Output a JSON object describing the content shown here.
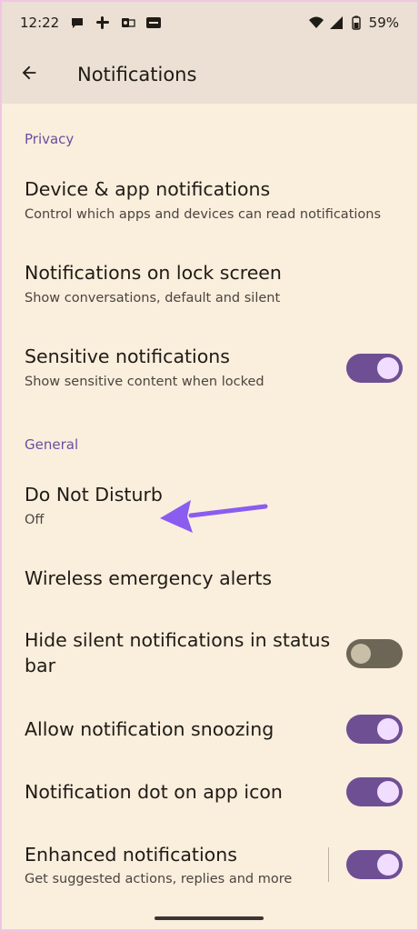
{
  "status_bar": {
    "time": "12:22",
    "battery": "59%",
    "icons": [
      "chat-bubble-icon",
      "slack-icon",
      "outlook-icon",
      "paytm-icon",
      "wifi-icon",
      "signal-icon",
      "battery-icon"
    ]
  },
  "app_bar": {
    "title": "Notifications"
  },
  "sections": {
    "privacy": "Privacy",
    "general": "General"
  },
  "items": {
    "device_app": {
      "title": "Device & app notifications",
      "subtitle": "Control which apps and devices can read notifications"
    },
    "lock_screen": {
      "title": "Notifications on lock screen",
      "subtitle": "Show conversations, default and silent"
    },
    "sensitive": {
      "title": "Sensitive notifications",
      "subtitle": "Show sensitive content when locked",
      "on": true
    },
    "dnd": {
      "title": "Do Not Disturb",
      "subtitle": "Off"
    },
    "wireless": {
      "title": "Wireless emergency alerts"
    },
    "hide_silent": {
      "title": "Hide silent notifications in status bar",
      "on": false
    },
    "snoozing": {
      "title": "Allow notification snoozing",
      "on": true
    },
    "dot": {
      "title": "Notification dot on app icon",
      "on": true
    },
    "enhanced": {
      "title": "Enhanced notifications",
      "subtitle": "Get suggested actions, replies and more",
      "on": true
    }
  },
  "colors": {
    "background": "#FAEEDD",
    "accent": "#6E4F94",
    "annotation_arrow": "#8A5CF0"
  }
}
